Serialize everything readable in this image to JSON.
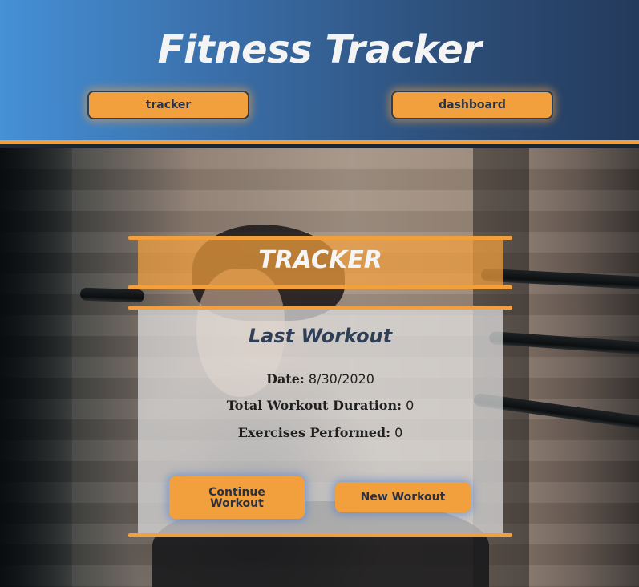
{
  "app": {
    "title": "Fitness Tracker"
  },
  "nav": {
    "tracker_label": "tracker",
    "dashboard_label": "dashboard"
  },
  "card": {
    "heading": "TRACKER",
    "subheading": "Last Workout",
    "stats": [
      {
        "label": "Date:",
        "value": "8/30/2020"
      },
      {
        "label": "Total Workout Duration:",
        "value": "0"
      },
      {
        "label": "Exercises Performed:",
        "value": "0"
      }
    ],
    "continue_label": "Continue Workout",
    "new_label": "New Workout"
  },
  "colors": {
    "accent": "#f2a03d",
    "header_gradient_start": "#4590d6",
    "header_gradient_end": "#243a5c",
    "heading_text": "#2d3e55"
  },
  "background_image": "woman-with-rope-in-gym-photo"
}
